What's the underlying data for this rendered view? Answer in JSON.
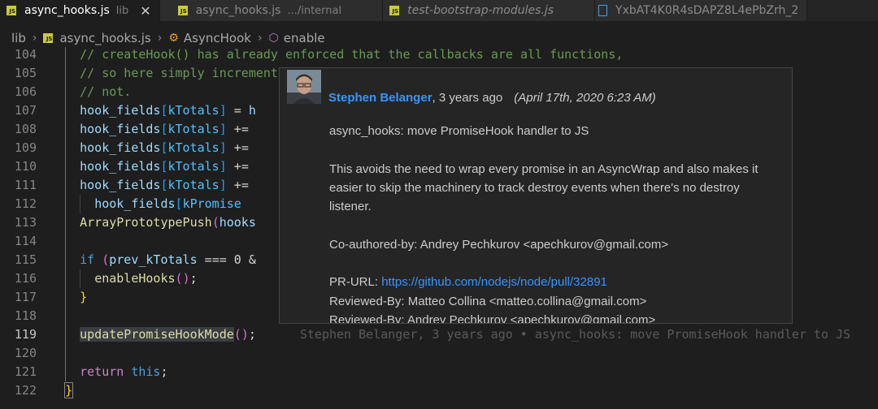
{
  "tabs": [
    {
      "name": "async_hooks.js",
      "desc": "lib",
      "active": true,
      "close": "✕"
    },
    {
      "name": "async_hooks.js",
      "desc": ".../internal",
      "active": false
    },
    {
      "name": "test-bootstrap-modules.js",
      "desc": "",
      "active": false
    },
    {
      "name": "YxbAT4K0R4sDAPZ8L4ePbZrh_2",
      "desc": "",
      "active": false
    }
  ],
  "breadcrumb": {
    "folder": "lib",
    "file": "async_hooks.js",
    "class": "AsyncHook",
    "method": "enable"
  },
  "lines": [
    {
      "num": "104",
      "text": "    // createHook() has already enforced that the callbacks are all functions,"
    },
    {
      "num": "105",
      "text": "    // so here simply increment"
    },
    {
      "num": "106",
      "text": "    // not."
    },
    {
      "num": "107",
      "text": "    hook_fields[kTotals] = h"
    },
    {
      "num": "108",
      "text": "    hook_fields[kTotals] += "
    },
    {
      "num": "109",
      "text": "    hook_fields[kTotals] += "
    },
    {
      "num": "110",
      "text": "    hook_fields[kTotals] += "
    },
    {
      "num": "111",
      "text": "    hook_fields[kTotals] += "
    },
    {
      "num": "112",
      "text": "      hook_fields[kPromise"
    },
    {
      "num": "113",
      "text": "    ArrayPrototypePush(hooks"
    },
    {
      "num": "114",
      "text": ""
    },
    {
      "num": "115",
      "text": "    if (prev_kTotals === 0 &"
    },
    {
      "num": "116",
      "text": "      enableHooks();"
    },
    {
      "num": "117",
      "text": "    }"
    },
    {
      "num": "118",
      "text": ""
    },
    {
      "num": "119",
      "text": "    updatePromiseHookMode();"
    },
    {
      "num": "120",
      "text": ""
    },
    {
      "num": "121",
      "text": "    return this;"
    },
    {
      "num": "122",
      "text": "  }"
    }
  ],
  "blame_inline": "Stephen Belanger, 3 years ago • async_hooks: move PromiseHook handler to JS",
  "hover": {
    "author": "Stephen Belanger",
    "relative_time": ", 3 years ago",
    "date": "(April 17th, 2020 6:23 AM)",
    "subject": "async_hooks: move PromiseHook handler to JS",
    "body": "This avoids the need to wrap every promise in an AsyncWrap and also makes it easier to skip the machinery to track destroy events when there's no destroy listener.",
    "coauthor": "Co-authored-by: Andrey Pechkurov <apechkurov@gmail.com>",
    "pr_label": "PR-URL: ",
    "pr_url": "https://github.com/nodejs/node/pull/32891",
    "reviewed1": "Reviewed-By: Matteo Collina <matteo.collina@gmail.com>",
    "reviewed2": "Reviewed-By: Andrey Pechkurov <apechkurov@gmail.com>"
  },
  "colors": {
    "author": "#3794ff",
    "comment": "#6a9955",
    "keyword": "#569cd6",
    "function": "#dcdcaa",
    "variable": "#4fc1ff"
  }
}
